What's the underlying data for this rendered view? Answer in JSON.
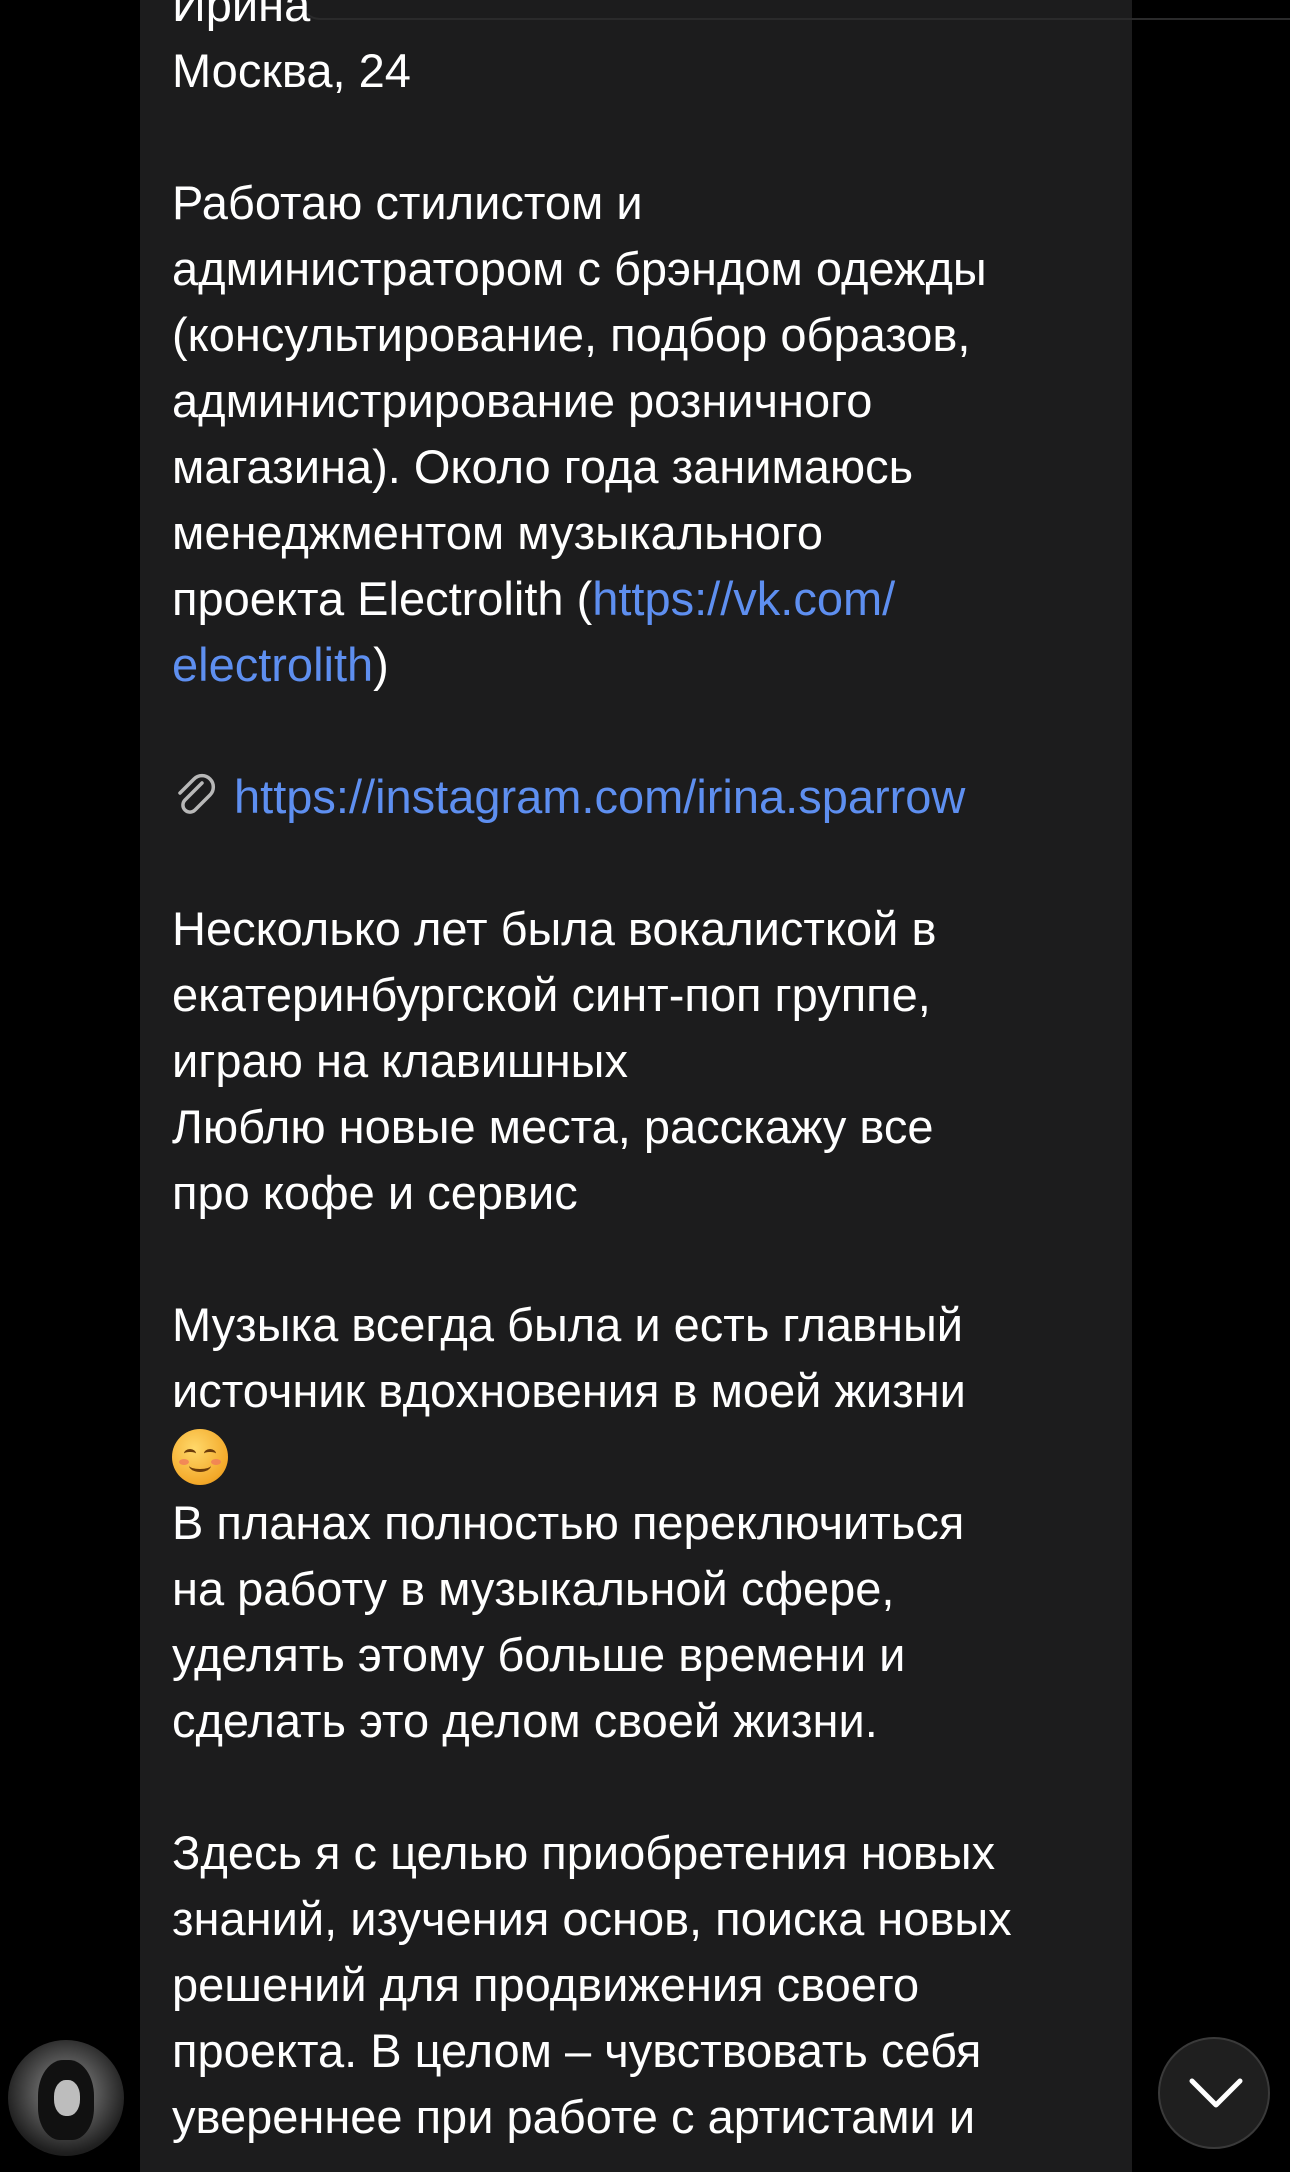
{
  "message": {
    "lines": [
      "Ирина",
      "Москва, 24",
      "",
      "Работаю стилистом и",
      "администратором с брэндом одежды",
      "(консультирование, подбор образов,",
      "администрирование розничного",
      "магазина). Около года занимаюсь",
      "менеджментом музыкального",
      "проекта Electrolith (",
      "electrolith",
      "",
      "https://instagram.com/irina.sparrow",
      "",
      "Несколько лет была вокалисткой в",
      "екатеринбургской синт-поп группе,",
      "играю на клавишных",
      "Люблю новые места, расскажу все",
      "про кофе и сервис",
      "",
      "Музыка всегда была и есть главный",
      "источник вдохновения в моей жизни",
      "",
      "В планах полностью переключиться",
      "на работу в музыкальной сфере,",
      "уделять этому больше времени и",
      "сделать это делом своей жизни.",
      "",
      "Здесь я с целью приобретения новых",
      "знаний, изучения основ, поиска новых",
      "решений для продвижения своего",
      "проекта. В целом – чувствовать себя",
      "увереннее при работе с артистами и"
    ],
    "vk_link_part1": "https://vk.com/",
    "vk_link_part2": "electrolith",
    "vk_close": ")",
    "emoji": "smiling-face-emoji"
  },
  "icons": {
    "attachment": "paperclip-icon",
    "scroll_down": "chevron-down-icon"
  },
  "colors": {
    "background": "#000000",
    "bubble": "#1c1c1d",
    "text": "#ffffff",
    "link": "#5e8ff0"
  }
}
